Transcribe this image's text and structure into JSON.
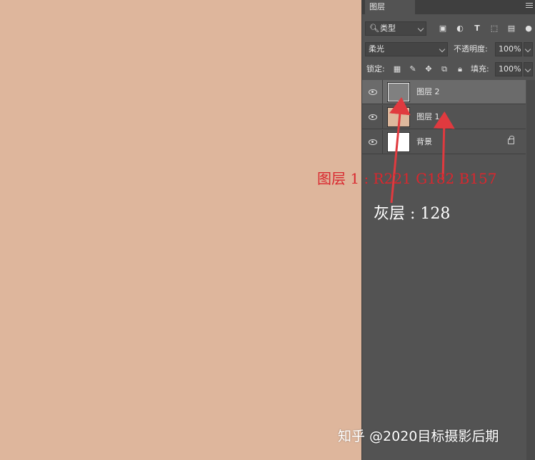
{
  "panel": {
    "tab_label": "图层",
    "filter": {
      "label": "类型"
    },
    "blend_mode": "柔光",
    "opacity": {
      "label": "不透明度:",
      "value": "100%"
    },
    "lock": {
      "label": "锁定:"
    },
    "fill": {
      "label": "填充:",
      "value": "100%"
    }
  },
  "layers": [
    {
      "name": "图层 2",
      "selected": true,
      "thumb": "gray",
      "locked": false
    },
    {
      "name": "图层 1",
      "selected": false,
      "thumb": "skin",
      "locked": false
    },
    {
      "name": "背景",
      "selected": false,
      "thumb": "white",
      "locked": true
    }
  ],
  "annotations": {
    "layer1_note": "图层 1 : R221 G182 B157",
    "gray_note": "灰层 : 128",
    "watermark": "知乎 @2020目标摄影后期"
  },
  "colors": {
    "canvas": "#deb69c",
    "panel": "#535353",
    "arrow": "#e03a3f"
  }
}
